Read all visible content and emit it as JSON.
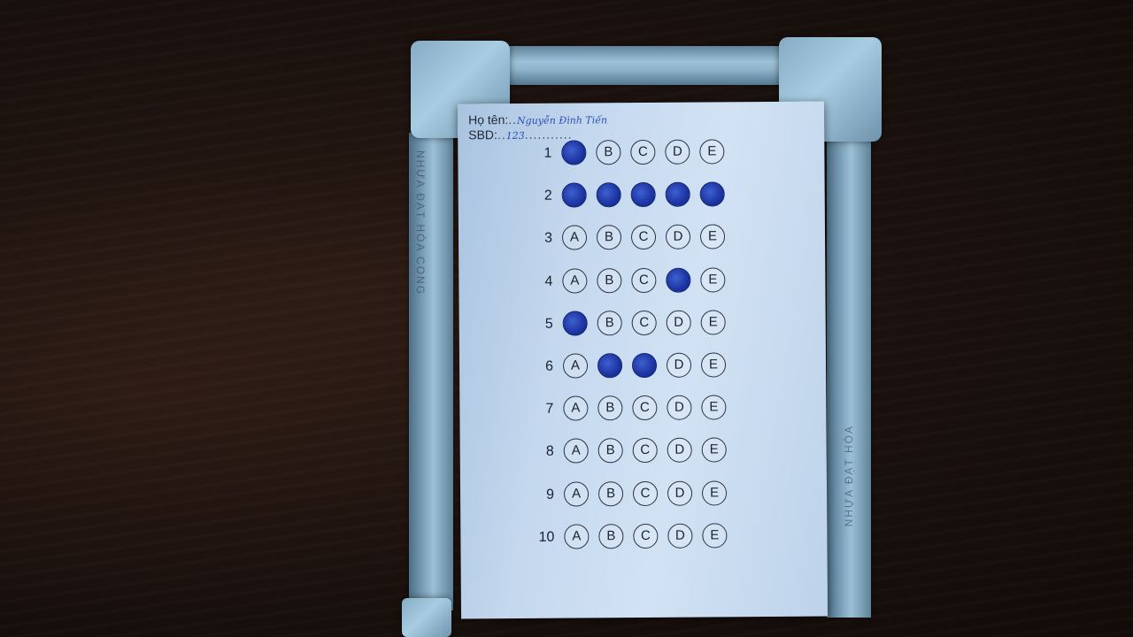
{
  "sheet": {
    "name_label": "Họ tên:",
    "name_value": "Nguyễn Đình Tiến",
    "id_label": "SBD:",
    "id_value": "123",
    "options": [
      "A",
      "B",
      "C",
      "D",
      "E"
    ],
    "questions": [
      {
        "number": "1",
        "filled": [
          "A"
        ]
      },
      {
        "number": "2",
        "filled": [
          "A",
          "B",
          "C",
          "D",
          "E"
        ]
      },
      {
        "number": "3",
        "filled": []
      },
      {
        "number": "4",
        "filled": [
          "D"
        ]
      },
      {
        "number": "5",
        "filled": [
          "A"
        ]
      },
      {
        "number": "6",
        "filled": [
          "B",
          "C"
        ]
      },
      {
        "number": "7",
        "filled": []
      },
      {
        "number": "8",
        "filled": []
      },
      {
        "number": "9",
        "filled": []
      },
      {
        "number": "10",
        "filled": []
      }
    ]
  },
  "frame": {
    "left_pipe_text": "NHỰA ĐẠT HÒA  CONG",
    "right_pipe_text": "NHỰA ĐẠT HÒA"
  },
  "colors": {
    "ink": "#1b34a0",
    "pipe": "#8fb4cb",
    "paper": "#c4d8ee"
  }
}
